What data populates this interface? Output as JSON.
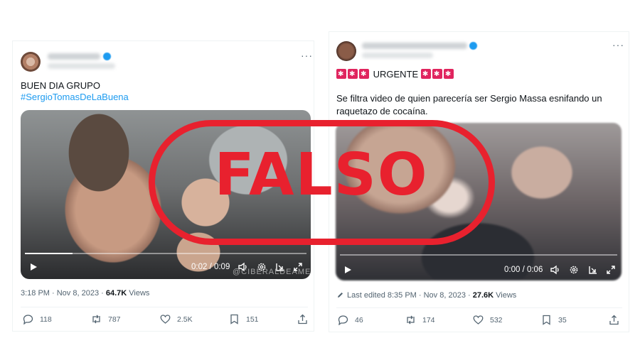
{
  "stamp": {
    "text": "FALSO",
    "color": "#e8212e"
  },
  "left_tweet": {
    "text_line1": "BUEN DIA GRUPO",
    "hashtag": "#SergioTomasDeLaBuena",
    "more_label": "···",
    "video": {
      "time": "0:02 / 0:09",
      "progress": 0.17,
      "watermark": "@CIBERALDEAMEI"
    },
    "timestamp": "3:18 PM · Nov 8, 2023 · ",
    "views_count": "64.7K",
    "views_label": " Views",
    "actions": {
      "replies": "118",
      "retweets": "787",
      "likes": "2.5K",
      "bookmarks": "151"
    }
  },
  "right_tweet": {
    "urgent_label": "URGENTE",
    "body_line1": "Se filtra video de quien parecería ser Sergio Massa esnifando un",
    "body_line2": "raquetazo de cocaína.",
    "more_label": "···",
    "video": {
      "time": "0:00 / 0:06",
      "progress": 0.0
    },
    "edited": "Last edited 8:35 PM · Nov 8, 2023 · ",
    "views_count": "27.6K",
    "views_label": " Views",
    "actions": {
      "replies": "46",
      "retweets": "174",
      "likes": "532",
      "bookmarks": "35"
    }
  },
  "icons": [
    "reply-icon",
    "retweet-icon",
    "heart-icon",
    "bookmark-icon",
    "share-icon",
    "play-icon",
    "volume-icon",
    "settings-icon",
    "pip-icon",
    "fullscreen-icon",
    "verified-icon",
    "pencil-icon",
    "alert-light-icon"
  ],
  "colors": {
    "link": "#1d9bf0",
    "muted": "#536471",
    "text": "#0f1419"
  }
}
